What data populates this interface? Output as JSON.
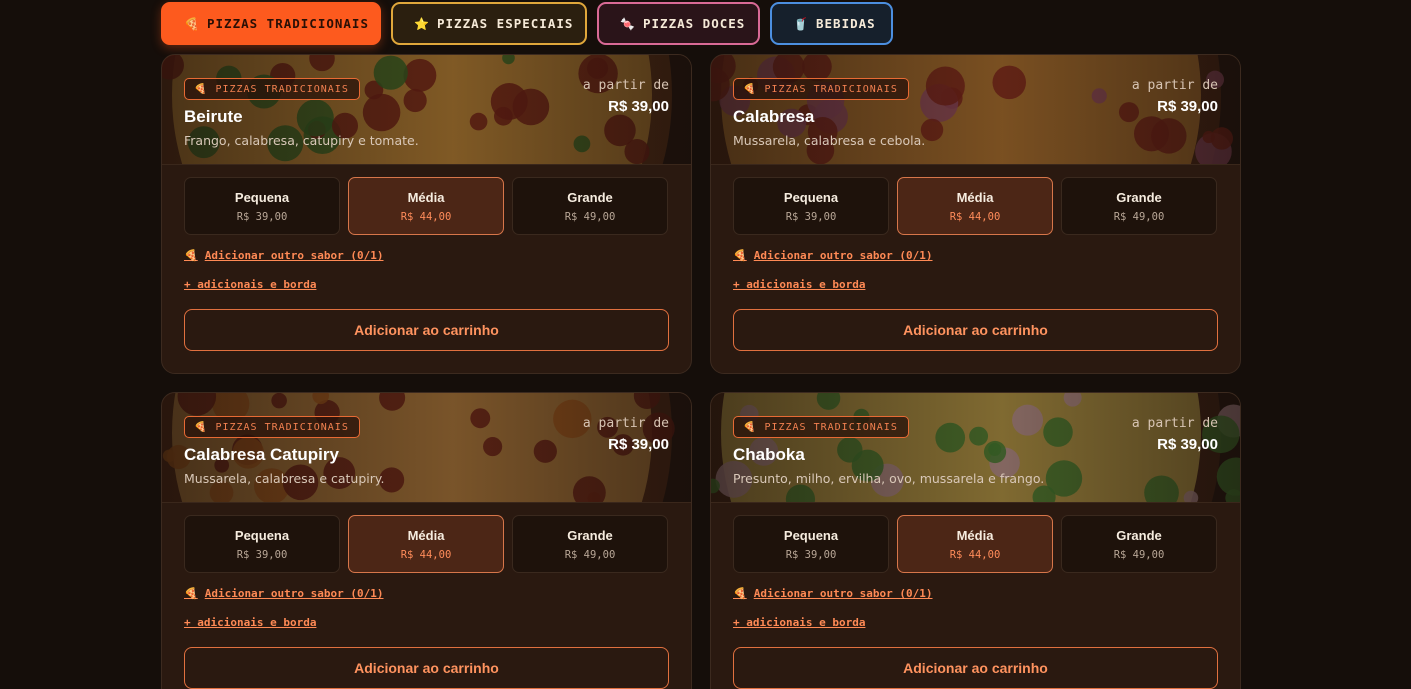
{
  "tabs": [
    {
      "icon": "pizza-slice-icon",
      "glyph": "🍕",
      "label": "PIZZAS TRADICIONAIS",
      "active": true
    },
    {
      "icon": "star-icon",
      "glyph": "⭐",
      "label": "PIZZAS ESPECIAIS",
      "active": false
    },
    {
      "icon": "candy-icon",
      "glyph": "🍬",
      "label": "PIZZAS DOCES",
      "active": false
    },
    {
      "icon": "cup-icon",
      "glyph": "🥤",
      "label": "BEBIDAS",
      "active": false
    }
  ],
  "common": {
    "badge_label": "PIZZAS TRADICIONAIS",
    "badge_glyph": "🍕",
    "from_label": "a partir de",
    "add_flavor_label": "Adicionar outro sabor (0/1)",
    "add_flavor_glyph": "🍕",
    "extras_label": "+ adicionais e borda",
    "cart_label": "Adicionar ao carrinho"
  },
  "products": [
    {
      "name": "Beirute",
      "description": "Frango, calabresa, catupiry e tomate.",
      "from_price": "R$ 39,00",
      "sizes": [
        {
          "name": "Pequena",
          "price": "R$ 39,00",
          "active": false
        },
        {
          "name": "Média",
          "price": "R$ 44,00",
          "active": true
        },
        {
          "name": "Grande",
          "price": "R$ 49,00",
          "active": false
        }
      ]
    },
    {
      "name": "Calabresa",
      "description": "Mussarela, calabresa e cebola.",
      "from_price": "R$ 39,00",
      "sizes": [
        {
          "name": "Pequena",
          "price": "R$ 39,00",
          "active": false
        },
        {
          "name": "Média",
          "price": "R$ 44,00",
          "active": true
        },
        {
          "name": "Grande",
          "price": "R$ 49,00",
          "active": false
        }
      ]
    },
    {
      "name": "Calabresa Catupiry",
      "description": "Mussarela, calabresa e catupiry.",
      "from_price": "R$ 39,00",
      "sizes": [
        {
          "name": "Pequena",
          "price": "R$ 39,00",
          "active": false
        },
        {
          "name": "Média",
          "price": "R$ 44,00",
          "active": true
        },
        {
          "name": "Grande",
          "price": "R$ 49,00",
          "active": false
        }
      ]
    },
    {
      "name": "Chaboka",
      "description": "Presunto, milho, ervilha, ovo, mussarela e frango.",
      "from_price": "R$ 39,00",
      "sizes": [
        {
          "name": "Pequena",
          "price": "R$ 39,00",
          "active": false
        },
        {
          "name": "Média",
          "price": "R$ 44,00",
          "active": true
        },
        {
          "name": "Grande",
          "price": "R$ 49,00",
          "active": false
        }
      ]
    }
  ]
}
